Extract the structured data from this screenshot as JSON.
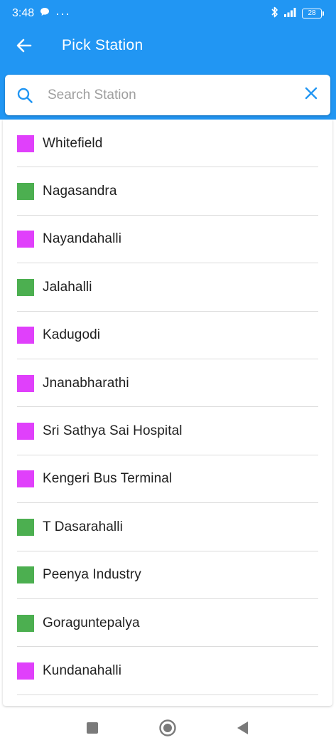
{
  "status_bar": {
    "time": "3:48",
    "dots": "···",
    "battery": "28"
  },
  "app_bar": {
    "title": "Pick Station"
  },
  "search": {
    "placeholder": "Search Station",
    "value": ""
  },
  "colors": {
    "primary": "#2196f3",
    "purple_line": "#e040fb",
    "green_line": "#4caf50"
  },
  "stations": [
    {
      "name": "Whitefield",
      "line": "purple"
    },
    {
      "name": "Nagasandra",
      "line": "green"
    },
    {
      "name": "Nayandahalli",
      "line": "purple"
    },
    {
      "name": "Jalahalli",
      "line": "green"
    },
    {
      "name": "Kadugodi",
      "line": "purple"
    },
    {
      "name": "Jnanabharathi",
      "line": "purple"
    },
    {
      "name": "Sri Sathya Sai Hospital",
      "line": "purple"
    },
    {
      "name": "Kengeri Bus Terminal",
      "line": "purple"
    },
    {
      "name": "T Dasarahalli",
      "line": "green"
    },
    {
      "name": "Peenya Industry",
      "line": "green"
    },
    {
      "name": "Goraguntepalya",
      "line": "green"
    },
    {
      "name": "Kundanahalli",
      "line": "purple"
    }
  ]
}
